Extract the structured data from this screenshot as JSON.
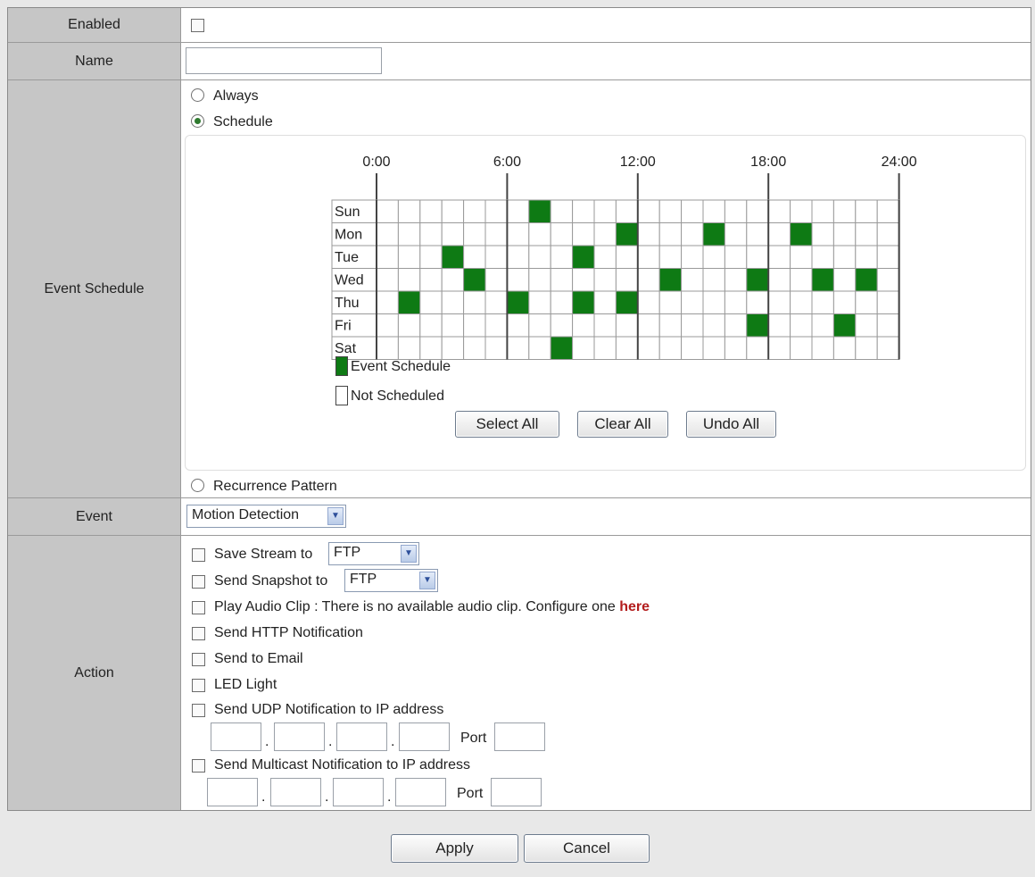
{
  "enabled": {
    "label": "Enabled",
    "checked": false
  },
  "name": {
    "label": "Name",
    "value": ""
  },
  "event_schedule": {
    "label": "Event Schedule",
    "option_always": "Always",
    "option_schedule": "Schedule",
    "option_recurrence": "Recurrence Pattern",
    "selected": "Schedule",
    "time_labels": [
      "0:00",
      "6:00",
      "12:00",
      "18:00",
      "24:00"
    ],
    "days": [
      "Sun",
      "Mon",
      "Tue",
      "Wed",
      "Thu",
      "Fri",
      "Sat"
    ],
    "slots_per_day": 24,
    "scheduled_slots": {
      "Sun": [
        7
      ],
      "Mon": [
        11,
        15,
        19
      ],
      "Tue": [
        3,
        9
      ],
      "Wed": [
        4,
        13,
        17,
        20,
        22
      ],
      "Thu": [
        1,
        6,
        9,
        11
      ],
      "Fri": [
        17,
        21
      ],
      "Sat": [
        8
      ]
    },
    "legend_scheduled": "Event Schedule",
    "legend_not_scheduled": "Not Scheduled",
    "scheduled_color": "#0e7a14",
    "select_all": "Select All",
    "clear_all": "Clear All",
    "undo_all": "Undo All"
  },
  "event": {
    "label": "Event",
    "selected": "Motion Detection"
  },
  "action": {
    "label": "Action",
    "save_stream": {
      "text": "Save Stream to",
      "target": "FTP",
      "checked": false
    },
    "send_snapshot": {
      "text": "Send Snapshot to",
      "target": "FTP",
      "checked": false
    },
    "play_audio": {
      "text": "Play Audio Clip : There is no available audio clip. Configure one",
      "link": "here",
      "checked": false
    },
    "send_http": {
      "text": "Send HTTP Notification",
      "checked": false
    },
    "send_email": {
      "text": "Send to Email",
      "checked": false
    },
    "led_light": {
      "text": "LED Light",
      "checked": false
    },
    "send_udp": {
      "text": "Send UDP Notification to IP address",
      "checked": false,
      "port_label": "Port",
      "ip": [
        "",
        "",
        "",
        ""
      ],
      "port": ""
    },
    "send_multicast": {
      "text": "Send Multicast Notification to IP address",
      "checked": false,
      "port_label": "Port",
      "ip": [
        "",
        "",
        "",
        ""
      ],
      "port": ""
    }
  },
  "buttons": {
    "apply": "Apply",
    "cancel": "Cancel"
  }
}
